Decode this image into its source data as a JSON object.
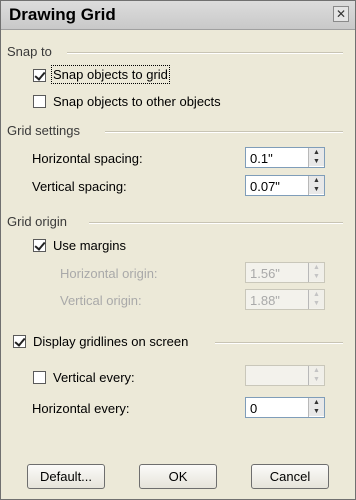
{
  "title": "Drawing Grid",
  "close_glyph": "✕",
  "snap_to": {
    "label": "Snap to",
    "snap_grid": {
      "label": "Snap objects to grid",
      "checked": true
    },
    "snap_objects": {
      "label": "Snap objects to other objects",
      "checked": false
    }
  },
  "grid_settings": {
    "label": "Grid settings",
    "horizontal_spacing": {
      "label": "Horizontal spacing:",
      "value": "0.1\""
    },
    "vertical_spacing": {
      "label": "Vertical spacing:",
      "value": "0.07\""
    }
  },
  "grid_origin": {
    "label": "Grid origin",
    "use_margins": {
      "label": "Use margins",
      "checked": true
    },
    "horizontal_origin": {
      "label": "Horizontal origin:",
      "value": "1.56\""
    },
    "vertical_origin": {
      "label": "Vertical origin:",
      "value": "1.88\""
    }
  },
  "display": {
    "label": "Display gridlines on screen",
    "checked": true,
    "vertical_every": {
      "label": "Vertical every:",
      "checked": false,
      "value": ""
    },
    "horizontal_every": {
      "label": "Horizontal every:",
      "value": "0"
    }
  },
  "buttons": {
    "default": "Default...",
    "ok": "OK",
    "cancel": "Cancel"
  },
  "spin_glyphs": {
    "up": "▲",
    "down": "▼"
  }
}
